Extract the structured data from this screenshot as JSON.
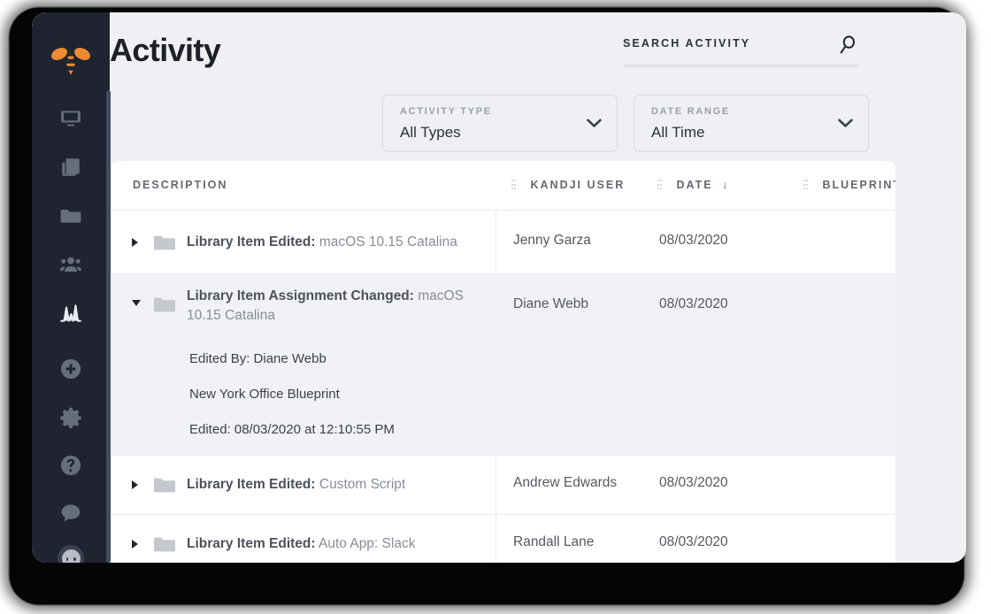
{
  "sidebar": {
    "logo": "bee-logo",
    "items": [
      {
        "icon": "monitor-icon",
        "name": "devices",
        "active": false
      },
      {
        "icon": "library-icon",
        "name": "library",
        "active": false
      },
      {
        "icon": "folder-icon",
        "name": "blueprints",
        "active": false
      },
      {
        "icon": "users-icon",
        "name": "users",
        "active": false
      },
      {
        "icon": "activity-icon",
        "name": "activity",
        "active": true
      },
      {
        "icon": "plus-circle-icon",
        "name": "add",
        "active": false
      },
      {
        "icon": "gear-icon",
        "name": "settings",
        "active": false
      },
      {
        "icon": "question-circle-icon",
        "name": "help",
        "active": false
      },
      {
        "icon": "chat-bubble-icon",
        "name": "chat",
        "active": false
      }
    ],
    "avatar": "user-avatar"
  },
  "header": {
    "title": "Activity",
    "search_label": "SEARCH ACTIVITY",
    "search_placeholder": "",
    "search_value": "",
    "search_icon": "search-icon"
  },
  "filters": [
    {
      "label": "ACTIVITY TYPE",
      "value": "All Types",
      "icon": "chevron-down-icon"
    },
    {
      "label": "DATE RANGE",
      "value": "All Time",
      "icon": "chevron-down-icon"
    }
  ],
  "table": {
    "columns": [
      {
        "key": "description",
        "label": "DESCRIPTION",
        "grip": false,
        "sorted": false
      },
      {
        "key": "user",
        "label": "KANDJI USER",
        "grip": true,
        "sorted": false
      },
      {
        "key": "date",
        "label": "DATE",
        "grip": true,
        "sorted": true,
        "sort_arrow": "↓"
      },
      {
        "key": "blueprint",
        "label": "BLUEPRINT",
        "grip": true,
        "sorted": false
      }
    ],
    "rows": [
      {
        "expanded": false,
        "icon": "folder-icon",
        "title": "Library Item Edited:",
        "subject": "macOS 10.15 Catalina",
        "user": "Jenny Garza",
        "date": "08/03/2020",
        "blueprint": ""
      },
      {
        "expanded": true,
        "icon": "folder-icon",
        "title": "Library Item Assignment Changed:",
        "subject": "macOS 10.15 Catalina",
        "user": "Diane Webb",
        "date": "08/03/2020",
        "blueprint": "",
        "details": [
          "Edited By: Diane Webb",
          "New York Office Blueprint",
          "Edited: 08/03/2020 at 12:10:55 PM"
        ]
      },
      {
        "expanded": false,
        "icon": "folder-icon",
        "title": "Library Item Edited:",
        "subject": "Custom Script",
        "user": "Andrew Edwards",
        "date": "08/03/2020",
        "blueprint": ""
      },
      {
        "expanded": false,
        "icon": "folder-icon",
        "title": "Library Item Edited:",
        "subject": "Auto App: Slack",
        "user": "Randall Lane",
        "date": "08/03/2020",
        "blueprint": ""
      }
    ]
  },
  "colors": {
    "sidebar_bg": "#1f2430",
    "accent_orange": "#ef8a31",
    "page_bg": "#eef0f4",
    "card_bg": "#ffffff",
    "row_shaded": "#f0f2f5",
    "text_dark": "#1d2028",
    "text_muted": "#878c96"
  }
}
